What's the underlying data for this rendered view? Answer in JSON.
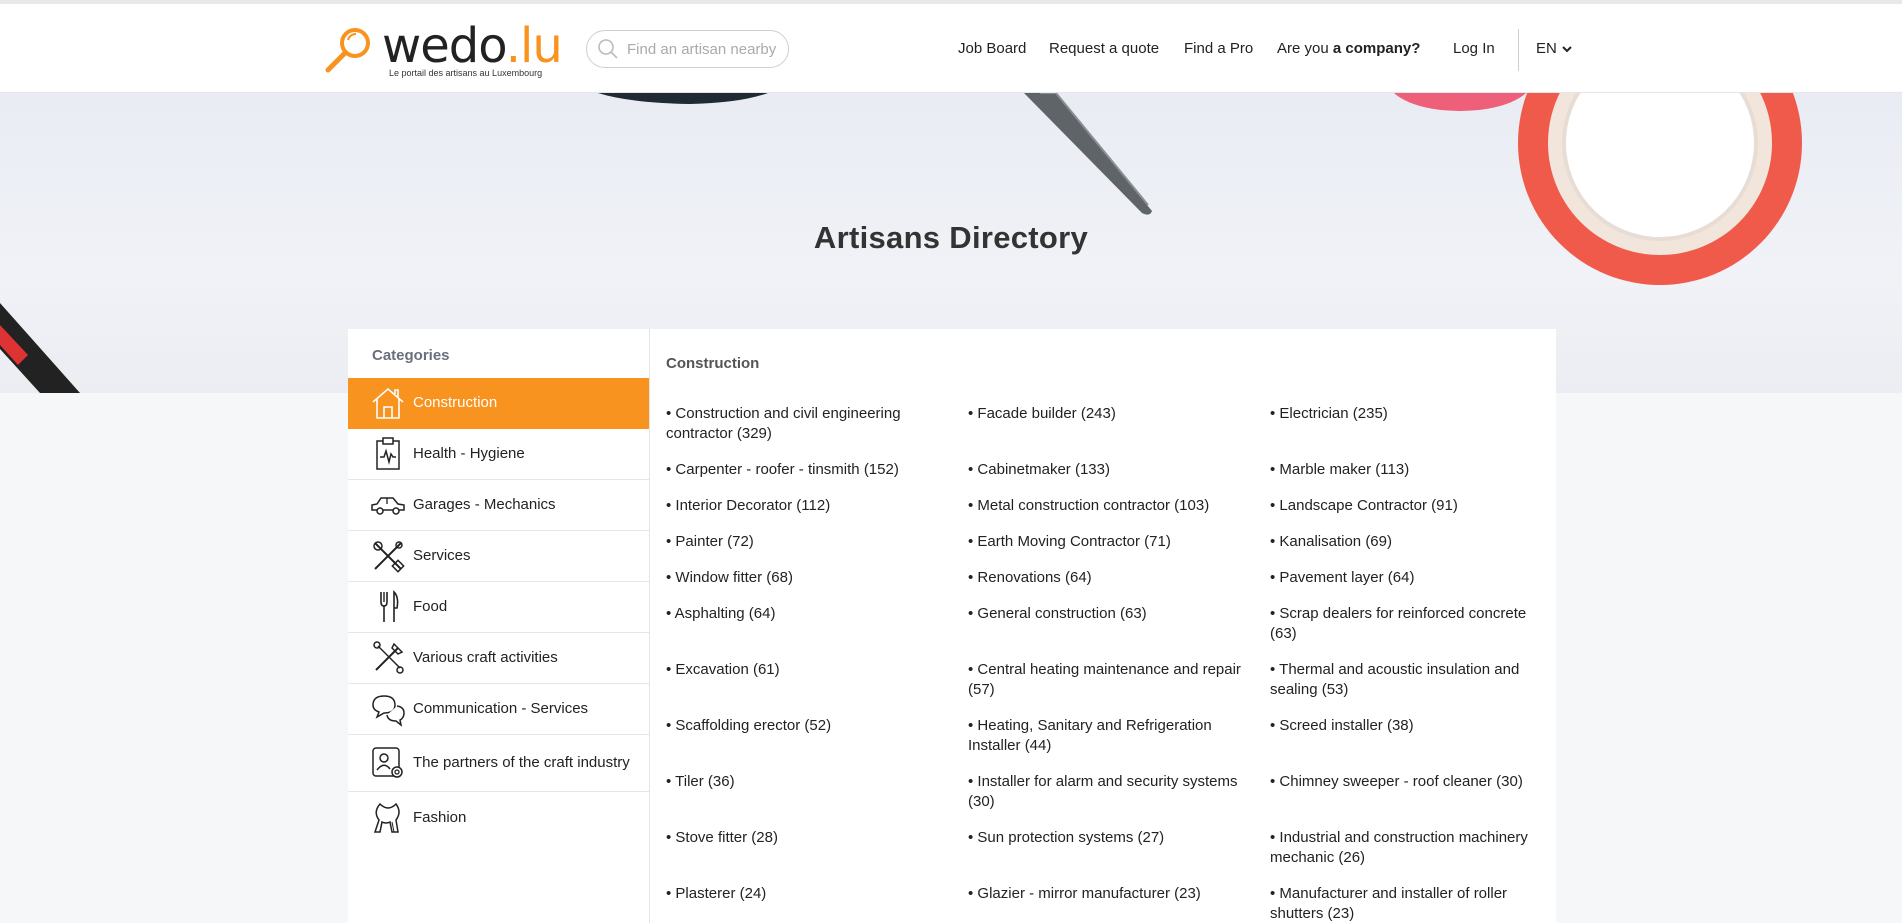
{
  "header": {
    "logo_main": "wedo",
    "logo_tld": ".lu",
    "logo_tagline": "Le portail des artisans au Luxembourg",
    "search_placeholder": "Find an artisan nearby",
    "nav": {
      "job_board": "Job Board",
      "request_quote": "Request a quote",
      "find_pro": "Find a Pro",
      "company_prefix": "Are you ",
      "company_bold": "a company?",
      "login": "Log In",
      "lang": "EN"
    },
    "accent_color": "#f7931e"
  },
  "hero": {
    "title": "Artisans Directory"
  },
  "sidebar": {
    "title": "Categories",
    "items": [
      {
        "label": "Construction",
        "icon": "house-icon",
        "active": true
      },
      {
        "label": "Health - Hygiene",
        "icon": "clipboard-health-icon",
        "active": false
      },
      {
        "label": "Garages - Mechanics",
        "icon": "car-icon",
        "active": false
      },
      {
        "label": "Services",
        "icon": "tools-icon",
        "active": false
      },
      {
        "label": "Food",
        "icon": "fork-knife-icon",
        "active": false
      },
      {
        "label": "Various craft activities",
        "icon": "craft-tools-icon",
        "active": false
      },
      {
        "label": "Communication - Services",
        "icon": "speech-bubbles-icon",
        "active": false
      },
      {
        "label": "The partners of the craft industry",
        "icon": "partner-gear-icon",
        "active": false
      },
      {
        "label": "Fashion",
        "icon": "scarf-icon",
        "active": false
      }
    ]
  },
  "content": {
    "title": "Construction",
    "rows": [
      [
        "Construction and civil engineering contractor (329)",
        "Facade builder (243)",
        "Electrician (235)"
      ],
      [
        "Carpenter - roofer - tinsmith (152)",
        "Cabinetmaker (133)",
        "Marble maker (113)"
      ],
      [
        "Interior Decorator (112)",
        "Metal construction contractor (103)",
        "Landscape Contractor (91)"
      ],
      [
        "Painter (72)",
        "Earth Moving Contractor (71)",
        "Kanalisation (69)"
      ],
      [
        "Window fitter (68)",
        "Renovations (64)",
        "Pavement layer (64)"
      ],
      [
        "Asphalting (64)",
        "General construction (63)",
        "Scrap dealers for reinforced concrete (63)"
      ],
      [
        "Excavation (61)",
        "Central heating maintenance and repair (57)",
        "Thermal and acoustic insulation and sealing (53)"
      ],
      [
        "Scaffolding erector (52)",
        "Heating, Sanitary and Refrigeration Installer (44)",
        "Screed installer (38)"
      ],
      [
        "Tiler (36)",
        "Installer for alarm and security systems (30)",
        "Chimney sweeper - roof cleaner (30)"
      ],
      [
        "Stove fitter (28)",
        "Sun protection systems (27)",
        "Industrial and construction machinery mechanic (26)"
      ],
      [
        "Plasterer (24)",
        "Glazier - mirror manufacturer (23)",
        "Manufacturer and installer of roller shutters (23)"
      ]
    ]
  }
}
